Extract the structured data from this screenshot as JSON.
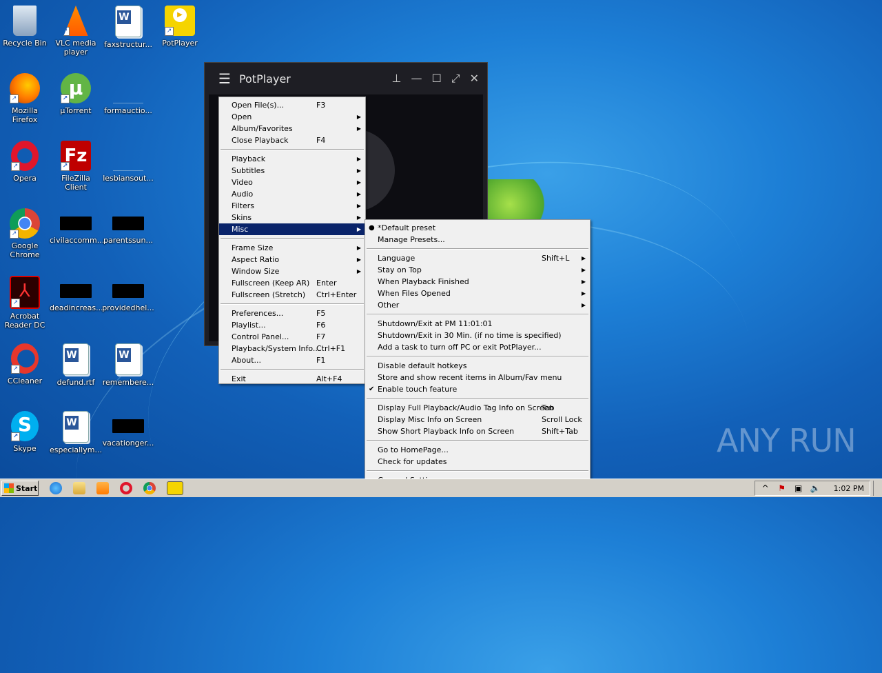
{
  "desktop": {
    "icons": [
      {
        "label": "Recycle Bin"
      },
      {
        "label": "VLC media player"
      },
      {
        "label": "faxstructur..."
      },
      {
        "label": "PotPlayer"
      },
      {
        "label": "Mozilla Firefox"
      },
      {
        "label": "µTorrent"
      },
      {
        "label": "formauctio..."
      },
      {
        "label": "Opera"
      },
      {
        "label": "FileZilla Client"
      },
      {
        "label": "lesbiansout..."
      },
      {
        "label": "Google Chrome"
      },
      {
        "label": "civilaccomm..."
      },
      {
        "label": "parentssun..."
      },
      {
        "label": "Acrobat Reader DC"
      },
      {
        "label": "deadincreas..."
      },
      {
        "label": "providedhel..."
      },
      {
        "label": "CCleaner"
      },
      {
        "label": "defund.rtf"
      },
      {
        "label": "remembere..."
      },
      {
        "label": "Skype"
      },
      {
        "label": "especiallym..."
      },
      {
        "label": "vacationger..."
      }
    ],
    "watermark": "ANY RUN"
  },
  "potplayer": {
    "title": "PotPlayer",
    "menu_icon": "hamburger-icon",
    "controls": [
      "pin-icon",
      "minimize-icon",
      "maximize-icon",
      "fullscreen-icon",
      "close-icon"
    ]
  },
  "main_menu": {
    "items": [
      {
        "label": "Open File(s)...",
        "shortcut": "F3"
      },
      {
        "label": "Open",
        "shortcut": ""
      },
      {
        "label": "Album/Favorites",
        "shortcut": ""
      },
      {
        "label": "Close Playback",
        "shortcut": "F4"
      },
      {
        "label": "Playback",
        "shortcut": ""
      },
      {
        "label": "Subtitles",
        "shortcut": ""
      },
      {
        "label": "Video",
        "shortcut": ""
      },
      {
        "label": "Audio",
        "shortcut": ""
      },
      {
        "label": "Filters",
        "shortcut": ""
      },
      {
        "label": "Skins",
        "shortcut": ""
      },
      {
        "label": "Misc",
        "shortcut": ""
      },
      {
        "label": "Frame Size",
        "shortcut": ""
      },
      {
        "label": "Aspect Ratio",
        "shortcut": ""
      },
      {
        "label": "Window Size",
        "shortcut": ""
      },
      {
        "label": "Fullscreen (Keep AR)",
        "shortcut": "Enter"
      },
      {
        "label": "Fullscreen (Stretch)",
        "shortcut": "Ctrl+Enter"
      },
      {
        "label": "Preferences...",
        "shortcut": "F5"
      },
      {
        "label": "Playlist...",
        "shortcut": "F6"
      },
      {
        "label": "Control Panel...",
        "shortcut": "F7"
      },
      {
        "label": "Playback/System Info...",
        "shortcut": "Ctrl+F1"
      },
      {
        "label": "About...",
        "shortcut": "F1"
      },
      {
        "label": "Exit",
        "shortcut": "Alt+F4"
      }
    ]
  },
  "misc_menu": {
    "items": [
      {
        "label": "*Default preset",
        "shortcut": ""
      },
      {
        "label": "Manage Presets...",
        "shortcut": ""
      },
      {
        "label": "Language",
        "shortcut": "Shift+L"
      },
      {
        "label": "Stay on Top",
        "shortcut": ""
      },
      {
        "label": "When Playback Finished",
        "shortcut": ""
      },
      {
        "label": "When Files Opened",
        "shortcut": ""
      },
      {
        "label": "Other",
        "shortcut": ""
      },
      {
        "label": "Shutdown/Exit at PM 11:01:01",
        "shortcut": ""
      },
      {
        "label": "Shutdown/Exit in 30 Min. (if no time is specified)",
        "shortcut": ""
      },
      {
        "label": "Add a task to turn off PC or exit PotPlayer...",
        "shortcut": ""
      },
      {
        "label": "Disable default hotkeys",
        "shortcut": ""
      },
      {
        "label": "Store and show recent items in Album/Fav menu",
        "shortcut": ""
      },
      {
        "label": "Enable touch feature",
        "shortcut": ""
      },
      {
        "label": "Display Full Playback/Audio Tag Info on Screen",
        "shortcut": "Tab"
      },
      {
        "label": "Display Misc Info on Screen",
        "shortcut": "Scroll Lock"
      },
      {
        "label": "Show Short Playback Info on Screen",
        "shortcut": "Shift+Tab"
      },
      {
        "label": "Go to HomePage...",
        "shortcut": ""
      },
      {
        "label": "Check for updates",
        "shortcut": ""
      },
      {
        "label": "General Settings...",
        "shortcut": ""
      }
    ]
  },
  "taskbar": {
    "start_label": "Start",
    "clock": "1:02 PM"
  },
  "colors": {
    "menu_highlight": "#0a246a",
    "menu_bg": "#f0f0f0",
    "desktop_blue": "#1d7fd6"
  }
}
